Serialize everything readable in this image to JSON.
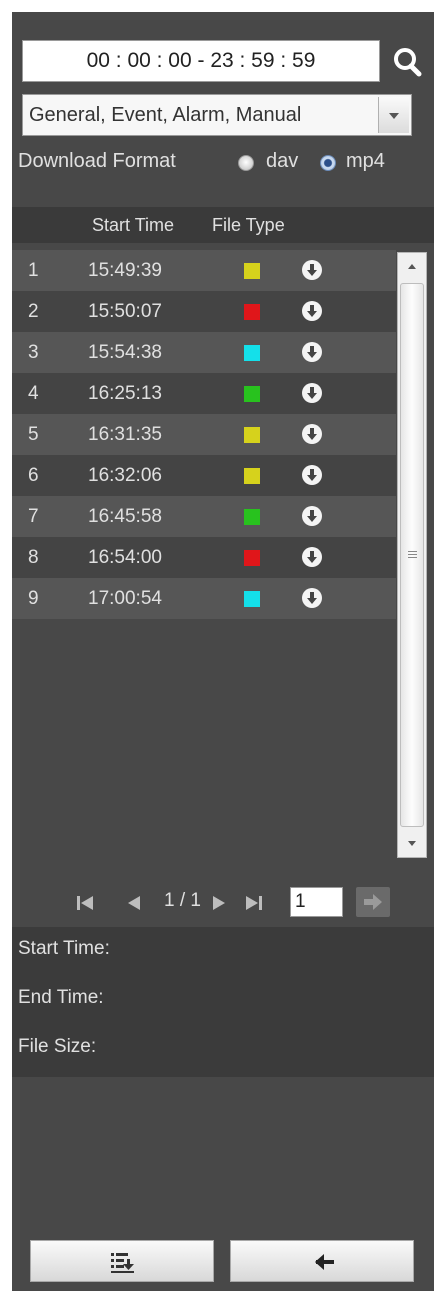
{
  "time_range": {
    "text": "00 : 00 : 00 - 23 : 59 : 59"
  },
  "search_icon": "search-icon",
  "record_type_select": {
    "value": "General, Event, Alarm, Manual"
  },
  "download_format": {
    "label": "Download Format",
    "options": [
      {
        "label": "dav",
        "selected": false
      },
      {
        "label": "mp4",
        "selected": true
      }
    ]
  },
  "table": {
    "headers": {
      "start_time": "Start Time",
      "file_type": "File Type"
    },
    "rows": [
      {
        "index": "1",
        "start_time": "15:49:39",
        "type_color": "#d6d21c"
      },
      {
        "index": "2",
        "start_time": "15:50:07",
        "type_color": "#e0161a"
      },
      {
        "index": "3",
        "start_time": "15:54:38",
        "type_color": "#14e0ea"
      },
      {
        "index": "4",
        "start_time": "16:25:13",
        "type_color": "#28c21e"
      },
      {
        "index": "5",
        "start_time": "16:31:35",
        "type_color": "#d6d21c"
      },
      {
        "index": "6",
        "start_time": "16:32:06",
        "type_color": "#d6d21c"
      },
      {
        "index": "7",
        "start_time": "16:45:58",
        "type_color": "#28c21e"
      },
      {
        "index": "8",
        "start_time": "16:54:00",
        "type_color": "#e0161a"
      },
      {
        "index": "9",
        "start_time": "17:00:54",
        "type_color": "#14e0ea"
      }
    ]
  },
  "pager": {
    "page_text": "1 / 1",
    "page_input": "1"
  },
  "info": {
    "start_time_label": "Start Time:",
    "end_time_label": "End Time:",
    "file_size_label": "File Size:"
  },
  "colors": {
    "panel_bg": "#484848",
    "row_odd": "#565656",
    "row_even": "#444444",
    "header_bg": "#3a3a3a",
    "info_bg": "#3b3b3b"
  }
}
